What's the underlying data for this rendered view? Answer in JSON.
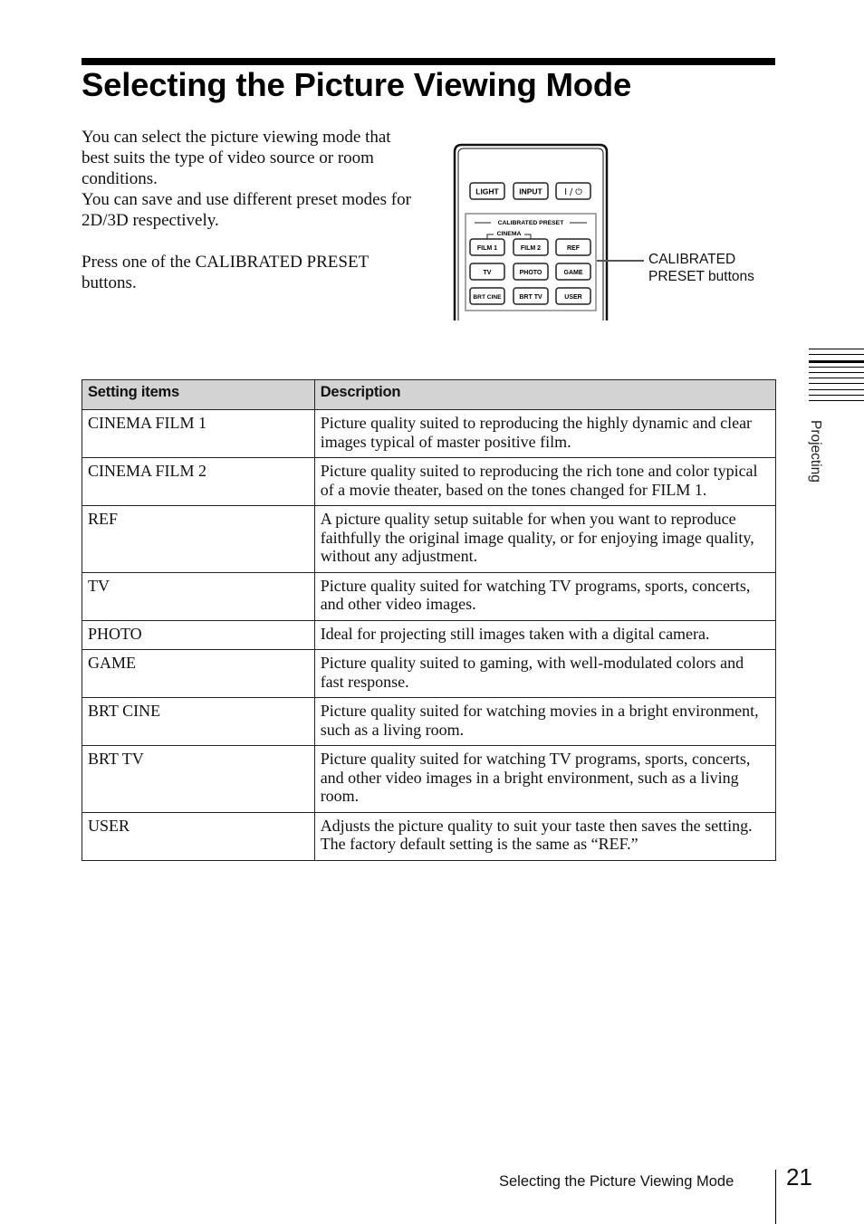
{
  "page": {
    "title": "Selecting the Picture Viewing Mode",
    "intro": {
      "paragraph1": "You can select the picture viewing mode that best suits the type of video source or room conditions.",
      "paragraph2": "You can save and use different preset modes for 2D/3D respectively.",
      "instruction": "Press one of the CALIBRATED PRESET buttons."
    }
  },
  "remote": {
    "top_buttons": [
      "LIGHT",
      "INPUT",
      "I / ⏻"
    ],
    "group_label": "CALIBRATED PRESET",
    "sub_label": "CINEMA",
    "preset_buttons": [
      [
        "FILM 1",
        "FILM 2",
        "REF"
      ],
      [
        "TV",
        "PHOTO",
        "GAME"
      ],
      [
        "BRT CINE",
        "BRT TV",
        "USER"
      ]
    ],
    "callout_line1": "CALIBRATED",
    "callout_line2": "PRESET buttons"
  },
  "table": {
    "headers": [
      "Setting items",
      "Description"
    ],
    "rows": [
      {
        "item": "CINEMA FILM 1",
        "description": "Picture quality suited to reproducing the highly dynamic and clear images typical of master positive film."
      },
      {
        "item": "CINEMA FILM 2",
        "description": "Picture quality suited to reproducing the rich tone and color typical of a movie theater, based on the tones changed for FILM 1."
      },
      {
        "item": "REF",
        "description": "A picture quality setup suitable for when you want to reproduce faithfully the original image quality, or for enjoying image quality, without any adjustment."
      },
      {
        "item": "TV",
        "description": "Picture quality suited for watching TV programs, sports, concerts, and other video images."
      },
      {
        "item": "PHOTO",
        "description": "Ideal for projecting still images taken with a digital camera."
      },
      {
        "item": "GAME",
        "description": "Picture quality suited to gaming, with well-modulated colors and fast response."
      },
      {
        "item": "BRT CINE",
        "description": "Picture quality suited for watching movies in a bright environment, such as a living room."
      },
      {
        "item": "BRT TV",
        "description": "Picture quality suited for watching TV programs, sports, concerts, and other video images in a bright environment, such as a living room."
      },
      {
        "item": "USER",
        "description": "Adjusts the picture quality to suit your taste then saves the setting. The factory default setting is the same as “REF.”"
      }
    ]
  },
  "side_tab": {
    "label": "Projecting"
  },
  "footer": {
    "running_title": "Selecting the Picture Viewing Mode",
    "page_number": "21"
  }
}
